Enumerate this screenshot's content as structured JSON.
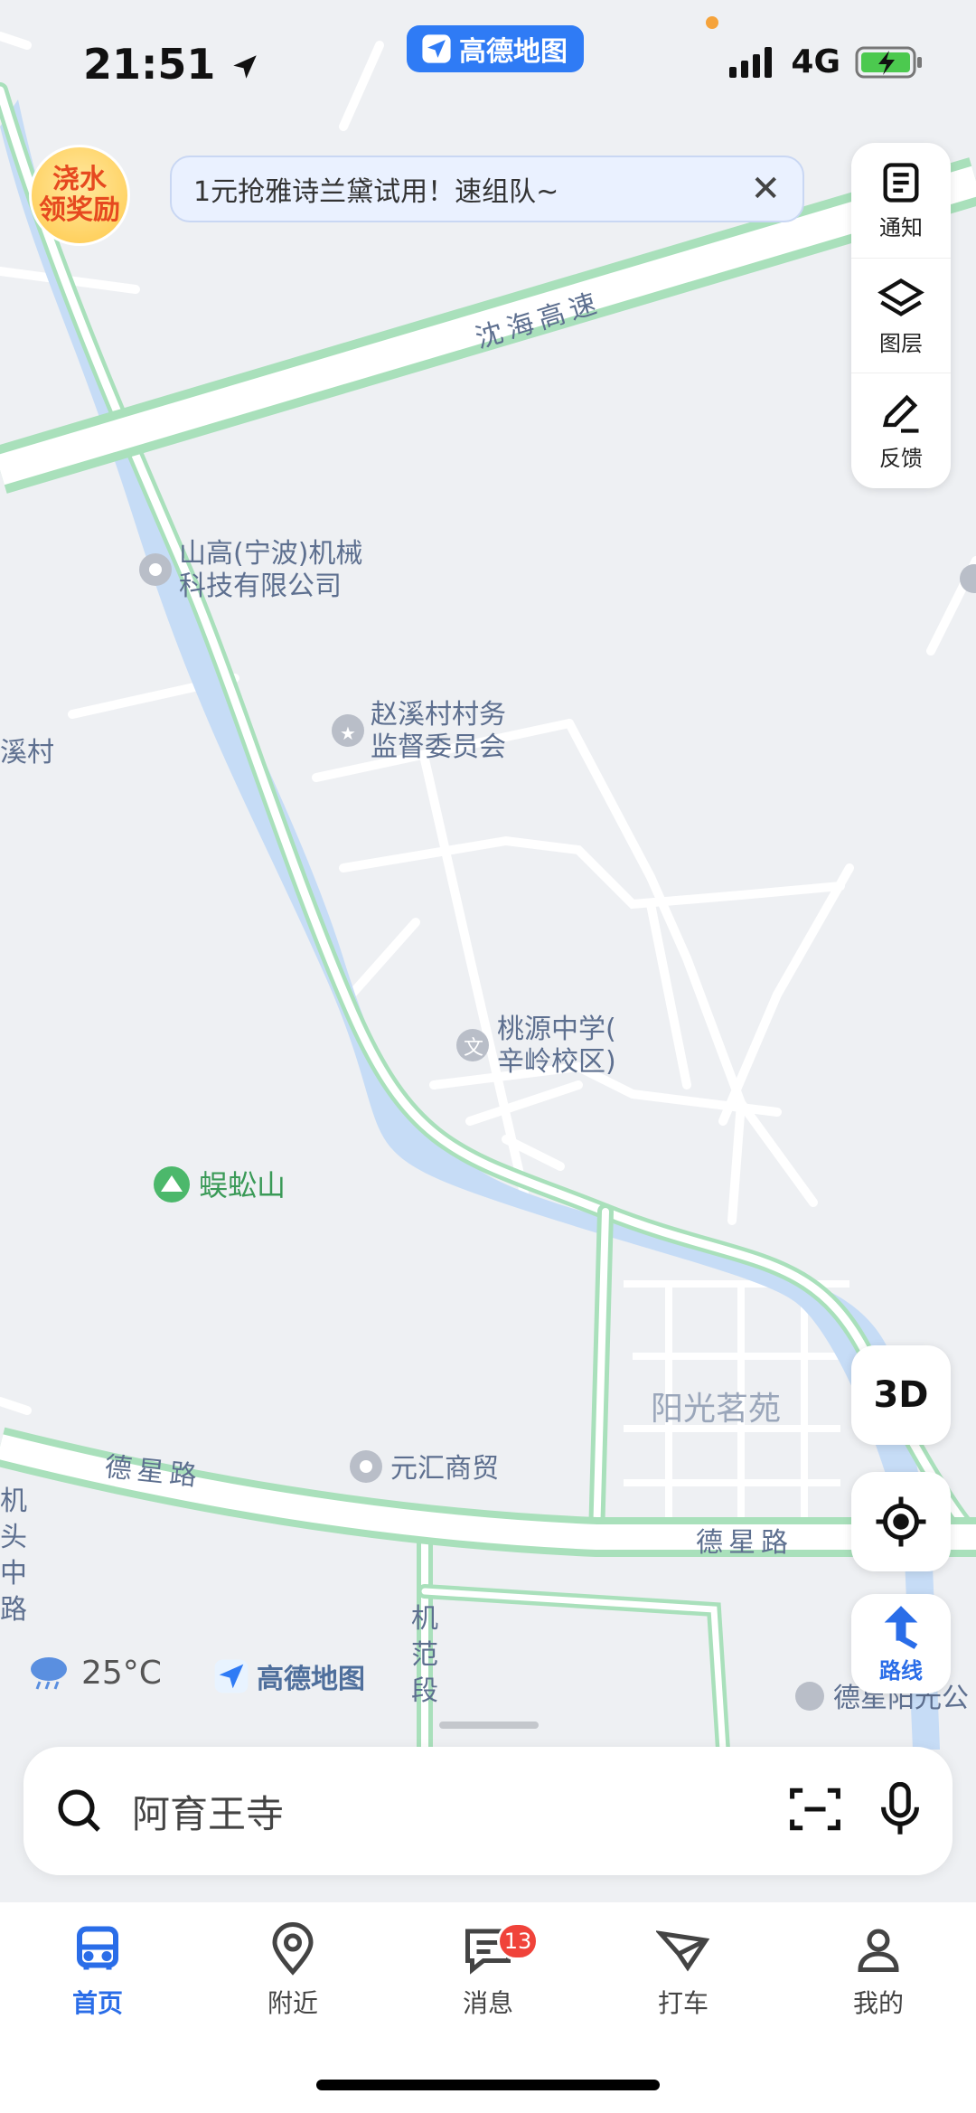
{
  "status": {
    "time": "21:51",
    "network": "4G"
  },
  "app_pill": "高德地图",
  "promo": {
    "badge_line1": "浇水",
    "badge_line2": "领奖励",
    "banner_text": "1元抢雅诗兰黛试用！速组队~"
  },
  "tools": [
    {
      "label": "通知",
      "icon": "notice-icon"
    },
    {
      "label": "图层",
      "icon": "layers-icon"
    },
    {
      "label": "反馈",
      "icon": "feedback-icon"
    }
  ],
  "map": {
    "roads": {
      "expressway": "沈海高速",
      "dexing_left": "德星路",
      "dexing_right": "德星路",
      "jifan": [
        "机",
        "范",
        "段"
      ],
      "jitou": [
        "机",
        "头",
        "中",
        "路"
      ]
    },
    "pois": {
      "shangao_1": "山高(宁波)机械",
      "shangao_2": "科技有限公司",
      "zhaoxi_1": "赵溪村村务",
      "zhaoxi_2": "监督委员会",
      "taoyuan_1": "桃源中学(",
      "taoyuan_2": "辛岭校区)",
      "mountain": "蜈蚣山",
      "yuanhui": "元汇商贸",
      "yangguang": "阳光茗苑",
      "dexing_yangguang": "德星阳光公",
      "xi_village": "溪村"
    }
  },
  "fab": {
    "three_d": "3D",
    "route": "路线"
  },
  "weather": {
    "temp": "25°C"
  },
  "logo_text": "高德地图",
  "search": {
    "placeholder": "阿育王寺"
  },
  "tabs": [
    {
      "label": "首页",
      "icon": "bus-icon",
      "active": true
    },
    {
      "label": "附近",
      "icon": "location-pin-icon"
    },
    {
      "label": "消息",
      "icon": "message-icon",
      "badge": "13"
    },
    {
      "label": "打车",
      "icon": "taxi-icon"
    },
    {
      "label": "我的",
      "icon": "profile-icon"
    }
  ],
  "colors": {
    "accent": "#2a6de8",
    "river": "#c6dcf6",
    "road_green": "#a9e0bb",
    "badge_red": "#f0433a"
  }
}
